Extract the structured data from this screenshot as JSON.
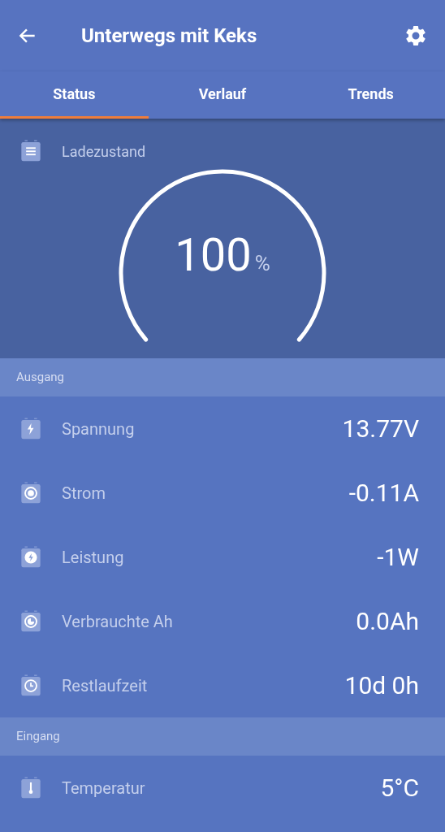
{
  "app_bar": {
    "title": "Unterwegs mit Keks"
  },
  "tabs": [
    {
      "label": "Status",
      "selected": true
    },
    {
      "label": "Verlauf",
      "selected": false
    },
    {
      "label": "Trends",
      "selected": false
    }
  ],
  "charge": {
    "label": "Ladezustand",
    "value": "100",
    "unit": "%"
  },
  "sections": [
    {
      "title": "Ausgang",
      "rows": [
        {
          "kind": "voltage",
          "label": "Spannung",
          "value": "13.77V"
        },
        {
          "kind": "current",
          "label": "Strom",
          "value": "-0.11A"
        },
        {
          "kind": "power",
          "label": "Leistung",
          "value": "-1W"
        },
        {
          "kind": "consumed",
          "label": "Verbrauchte Ah",
          "value": "0.0Ah"
        },
        {
          "kind": "time",
          "label": "Restlaufzeit",
          "value": "10d 0h"
        }
      ]
    },
    {
      "title": "Eingang",
      "rows": [
        {
          "kind": "temperature",
          "label": "Temperatur",
          "value": "5°C"
        }
      ]
    }
  ]
}
